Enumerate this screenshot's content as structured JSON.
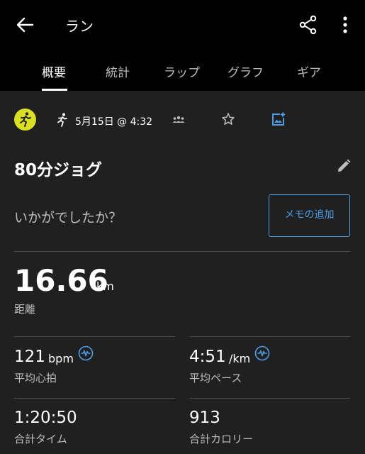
{
  "header": {
    "title": "ラン"
  },
  "tabs": [
    {
      "label": "概要"
    },
    {
      "label": "統計"
    },
    {
      "label": "ラップ"
    },
    {
      "label": "グラフ"
    },
    {
      "label": "ギア"
    }
  ],
  "activity": {
    "date": "5月15日 @ 4:32",
    "name": "80分ジョグ",
    "feeling_prompt": "いかがでしたか？",
    "memo_button": "メモの追加",
    "icon_color": "#d9e021"
  },
  "stats": {
    "distance": {
      "value": "16.66",
      "unit": "km",
      "label": "距離"
    },
    "heart_rate": {
      "value": "121",
      "unit": "bpm",
      "label": "平均心拍"
    },
    "pace": {
      "value": "4:51",
      "unit": "/km",
      "label": "平均ペース"
    },
    "time": {
      "value": "1:20:50",
      "label": "合計タイム"
    },
    "calories": {
      "value": "913",
      "label": "合計カロリー"
    }
  },
  "colors": {
    "accent": "#4a9ee8",
    "background": "#202020",
    "bar": "#000000"
  }
}
